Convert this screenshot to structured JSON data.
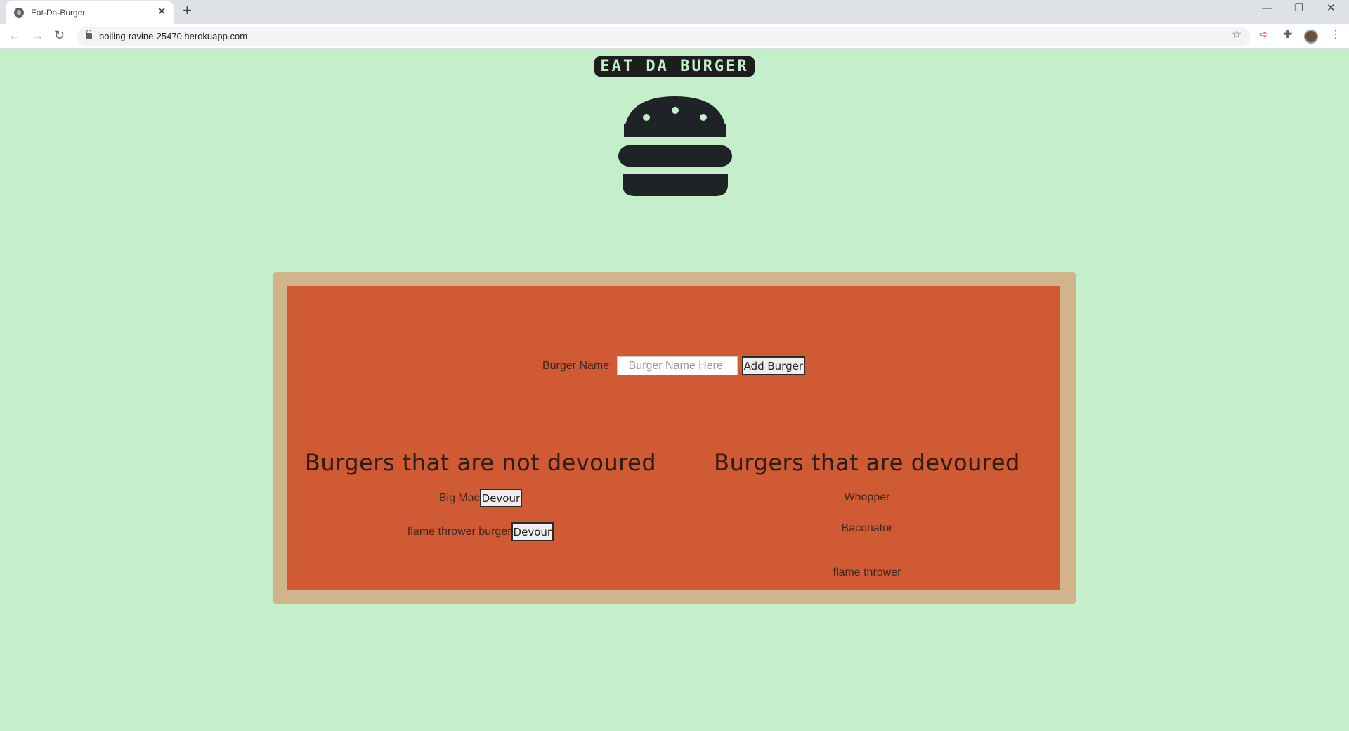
{
  "browser": {
    "tab_title": "Eat-Da-Burger",
    "tab_close": "✕",
    "new_tab": "+",
    "url": "boiling-ravine-25470.herokuapp.com",
    "window_controls": {
      "minimize": "—",
      "restore": "❐",
      "close": "✕"
    },
    "nav": {
      "back": "←",
      "forward": "→",
      "reload": "↻"
    },
    "icons": {
      "star": "☆",
      "extension_red": "➪",
      "puzzle": "✚",
      "menu": "⋮"
    }
  },
  "site": {
    "title": "EAT DA BURGER",
    "logo_icon": "burger-icon"
  },
  "form": {
    "label": "Burger Name:",
    "placeholder": "Burger Name Here",
    "value": "",
    "submit_label": "Add Burger"
  },
  "not_devoured": {
    "heading": "Burgers that are not devoured",
    "items": [
      {
        "name": "Big Mac",
        "button": "Devour"
      },
      {
        "name": "flame thrower burger",
        "button": "Devour"
      }
    ]
  },
  "devoured": {
    "heading": "Burgers that are devoured",
    "items": [
      {
        "name": "Whopper"
      },
      {
        "name": "Baconator"
      },
      {
        "name": "flame thrower"
      }
    ]
  },
  "colors": {
    "page_bg": "#c5efcb",
    "frame": "#d1b48c",
    "panel": "#d05a34",
    "logo": "#1d1d1f"
  }
}
